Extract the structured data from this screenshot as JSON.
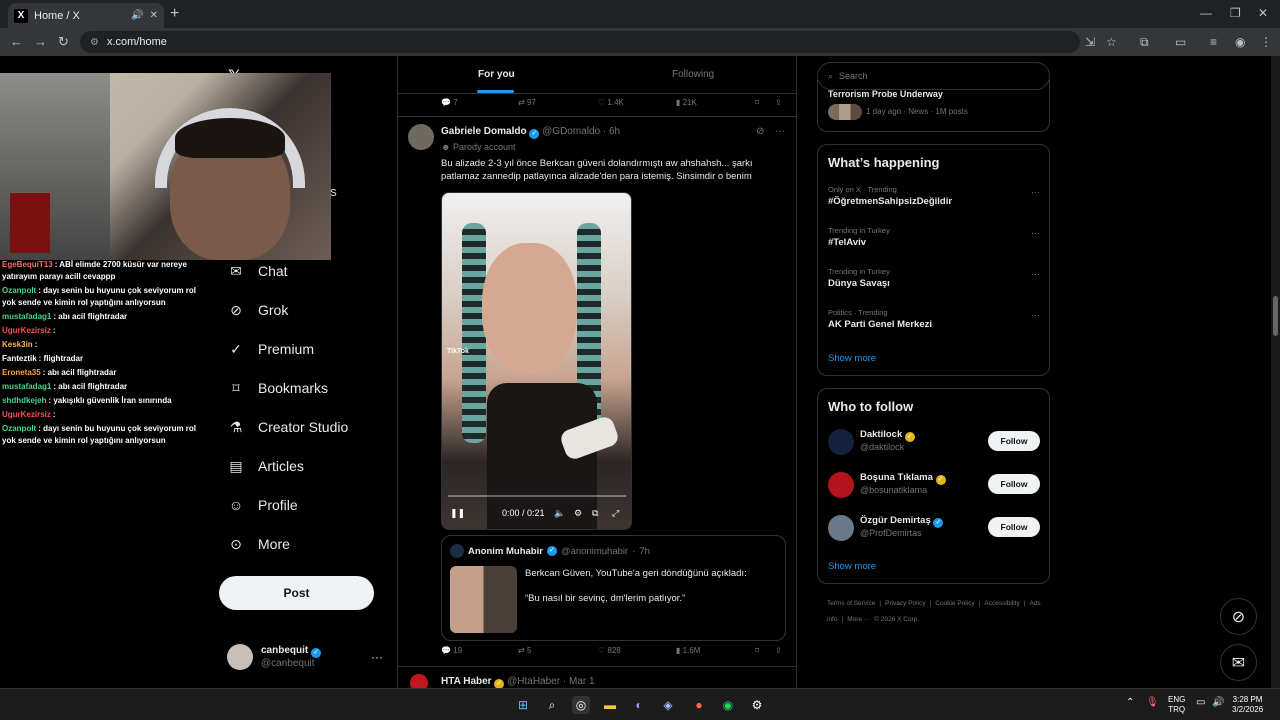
{
  "browser": {
    "tab_title": "Home / X",
    "tab_favicon": "X",
    "url": "x.com/home"
  },
  "stream_chat": [
    {
      "user": "EgeBequiT13",
      "color": "#ff6b6b",
      "text": ": ABİ elimde 2700 küsür var nereye yatırayım parayı acill cevappp"
    },
    {
      "user": "Ozanpolt",
      "color": "#4fd18b",
      "text": ": dayı senin bu huyunu çok seviyorum rol yok sende ve kimin rol yaptığını anlıyorsun"
    },
    {
      "user": "mustafadag1",
      "color": "#4fd18b",
      "text": ": abı acil flightradar"
    },
    {
      "user": "UgurKezirsiz",
      "color": "#ff4d4d",
      "text": ":"
    },
    {
      "user": "Kesk3in",
      "color": "#ffb347",
      "text": ":"
    },
    {
      "user": "Fanteztik",
      "color": "#ffffff",
      "text": ": flightradar"
    },
    {
      "user": "Eroneta35",
      "color": "#ff9f43",
      "text": ": abı acil flightradar"
    },
    {
      "user": "mustafadag1",
      "color": "#4fd18b",
      "text": ": abı acil flightradar"
    },
    {
      "user": "shdhdkejeh",
      "color": "#4fd18b",
      "text": ": yakışıklı güvenlik İran sınırında"
    },
    {
      "user": "UgurKezirsiz",
      "color": "#ff4d4d",
      "text": ":"
    },
    {
      "user": "Ozanpolt",
      "color": "#4fd18b",
      "text": ": dayı senin bu huyunu çok seviyorum rol yok sende ve kimin rol yaptığını anlıyorsun"
    }
  ],
  "nav": {
    "logo": "𝕏",
    "stray_letter": "S",
    "items": [
      {
        "label": "Chat",
        "icon": "mail-icon"
      },
      {
        "label": "Grok",
        "icon": "grok-icon"
      },
      {
        "label": "Premium",
        "icon": "premium-icon"
      },
      {
        "label": "Bookmarks",
        "icon": "bookmark-icon"
      },
      {
        "label": "Creator Studio",
        "icon": "flask-icon"
      },
      {
        "label": "Articles",
        "icon": "article-icon"
      },
      {
        "label": "Profile",
        "icon": "person-icon"
      },
      {
        "label": "More",
        "icon": "more-icon"
      }
    ],
    "post_label": "Post",
    "account": {
      "name": "canbequit",
      "handle": "@canbequit"
    }
  },
  "feed": {
    "tabs": [
      "For you",
      "Following"
    ],
    "prev_actions": {
      "replies": "7",
      "reposts": "97",
      "likes": "1.4K",
      "views": "21K"
    },
    "tweet": {
      "name": "Gabriele Domaldo",
      "handle": "@GDomaldo",
      "time": "6h",
      "label": "Parody account",
      "text": "Bu alizade 2-3 yıl önce Berkcan güveni dolandırmıştı aw ahshahsh... şarkı patlamaz zannedip patlayınca alizade'den para istemiş. Sinsimdir o benim",
      "video": {
        "time": "0:00 / 0:21",
        "watermark": "TikTok",
        "progress": 0
      },
      "quote": {
        "name": "Anonim Muhabir",
        "handle": "@anonimuhabir",
        "time": "7h",
        "line1": "Berkcan Güven, YouTube'a geri döndüğünü açıkladı:",
        "line2": "“Bu nasıl bir sevinç, dm'lerim patlıyor.”"
      },
      "actions": {
        "replies": "19",
        "reposts": "5",
        "likes": "828",
        "views": "1.6M"
      }
    },
    "next_tweet": {
      "name": "HTA Haber",
      "handle": "@HtaHaber",
      "time": "Mar 1"
    }
  },
  "sidebar": {
    "search_placeholder": "Search",
    "top_card": {
      "title": "Terrorism Probe Underway",
      "meta": "1 day ago · News · 1M posts"
    },
    "happening_title": "What’s happening",
    "trends": [
      {
        "context": "Only on X · Trending",
        "name": "#ÖğretmenSahipsizDeğildir"
      },
      {
        "context": "Trending in Turkey",
        "name": "#TelAviv"
      },
      {
        "context": "Trending in Turkey",
        "name": "Dünya Savaşı"
      },
      {
        "context": "Politics · Trending",
        "name": "AK Parti Genel Merkezi"
      }
    ],
    "show_more": "Show more",
    "who_to_follow_title": "Who to follow",
    "suggestions": [
      {
        "name": "Daktilock",
        "handle": "@daktilock",
        "badge": "gold",
        "avatar_color": "#14213d"
      },
      {
        "name": "Boşuna Tıklama",
        "handle": "@bosunatiklama",
        "badge": "gold",
        "avatar_color": "#b3131b"
      },
      {
        "name": "Özgür Demirtaş",
        "handle": "@ProfDemirtas",
        "badge": "blue",
        "avatar_color": "#6b7a8a"
      }
    ],
    "follow_label": "Follow",
    "footer": [
      "Terms of Service",
      "|",
      "Privacy Policy",
      "|",
      "Cookie Policy",
      "|",
      "Accessibility",
      "|",
      "Ads info",
      "|",
      "More ···",
      "© 2026 X Corp."
    ]
  },
  "taskbar": {
    "lang": "ENG",
    "region": "TRQ",
    "time": "3:28 PM",
    "date": "3/2/2026"
  }
}
